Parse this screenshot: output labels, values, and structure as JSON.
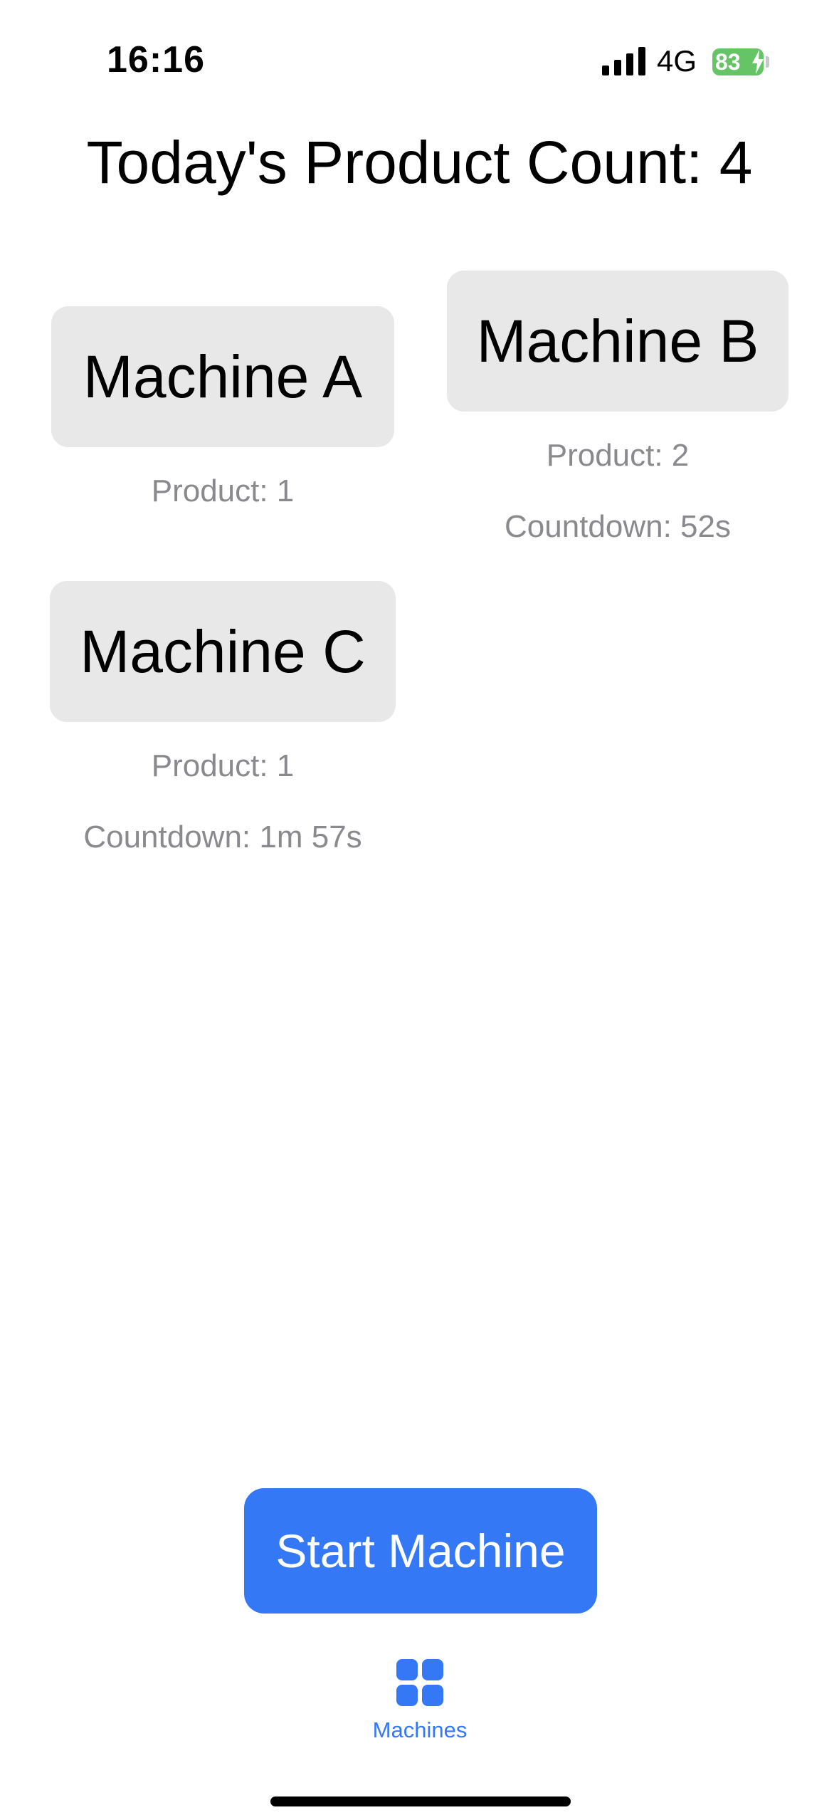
{
  "status_bar": {
    "time": "16:16",
    "network": "4G",
    "battery_level": "83"
  },
  "header": {
    "title": "Today's Product Count: 4"
  },
  "machines": [
    {
      "name": "Machine A",
      "product": "Product: 1",
      "countdown": ""
    },
    {
      "name": "Machine B",
      "product": "Product: 2",
      "countdown": "Countdown: 52s"
    },
    {
      "name": "Machine C",
      "product": "Product: 1",
      "countdown": "Countdown: 1m 57s"
    }
  ],
  "actions": {
    "start_label": "Start Machine"
  },
  "tab_bar": {
    "tabs": [
      {
        "label": "Machines",
        "icon": "grid-icon",
        "active": true
      }
    ]
  },
  "colors": {
    "accent": "#3478f6",
    "card_bg": "#e8e8e8",
    "secondary_text": "#8a8a8e",
    "battery": "#65c466"
  }
}
